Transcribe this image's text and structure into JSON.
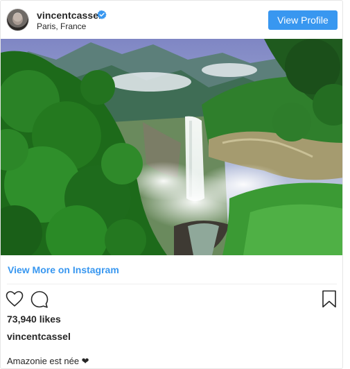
{
  "post": {
    "username": "vincentcassel",
    "location": "Paris, France",
    "view_profile_label": "View Profile",
    "view_more_label": "View More on Instagram",
    "likes": "73,940 likes",
    "caption_user": "vincentcassel",
    "caption_text": "Amazonie est née ❤"
  },
  "icons": [
    "verified-badge-icon",
    "heart-icon",
    "comment-icon",
    "bookmark-icon"
  ],
  "colors": {
    "accent": "#3897f0",
    "text": "#262626",
    "border": "#e6e6e6"
  }
}
